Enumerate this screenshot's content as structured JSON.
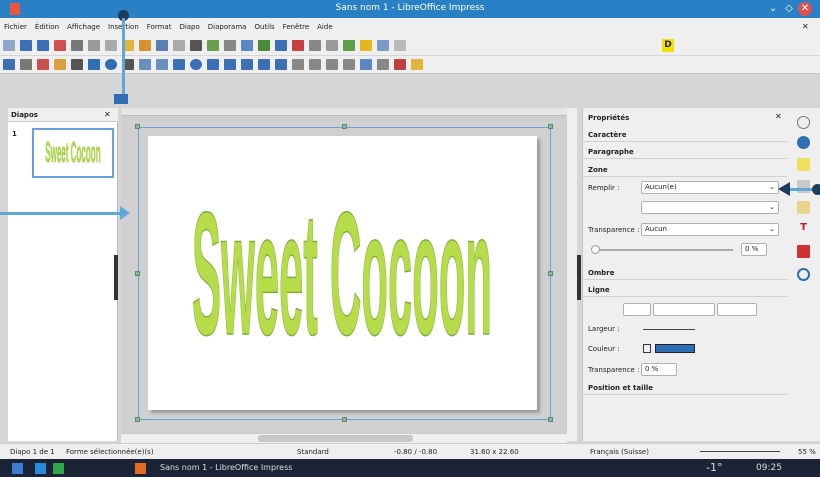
{
  "window": {
    "title": "Sans nom 1 - LibreOffice Impress"
  },
  "menus": [
    "Fichier",
    "Édition",
    "Affichage",
    "Insertion",
    "Format",
    "Diapo",
    "Diaporama",
    "Outils",
    "Fenêtre",
    "Aide"
  ],
  "slides_panel": {
    "title": "Diapos",
    "items": [
      {
        "number": "1",
        "text": "Sweet Cocoon"
      }
    ]
  },
  "slide": {
    "wordart": "Sweet Cocoon",
    "fill_color": "#b6dc4a",
    "stroke_color": "#7faa3a"
  },
  "properties": {
    "title": "Propriétés",
    "sections": {
      "caractere": "Caractère",
      "paragraphe": "Paragraphe",
      "zone": "Zone",
      "ombre": "Ombre",
      "ligne": "Ligne",
      "position": "Position et taille"
    },
    "zone": {
      "remplir_label": "Remplir :",
      "remplir_value": "Aucun(e)",
      "transparence_label": "Transparence :",
      "transparence_value": "Aucun",
      "transparence_percent": "0 %"
    },
    "ligne": {
      "largeur_label": "Largeur :",
      "couleur_label": "Couleur :",
      "transparence_label": "Transparence :",
      "transparence_value": "0 %",
      "line_color": "#2f6db4"
    }
  },
  "status": {
    "slide": "Diapo 1 de 1",
    "selection": "Forme sélectionnée(e)(s)",
    "layout": "Standard",
    "position": "-0.80 / -0.80",
    "size": "31.60 x 22.60",
    "language": "Français (Suisse)",
    "zoom": "55 %"
  },
  "taskbar": {
    "task": "Sans nom 1 - LibreOffice Impress",
    "temp": "-1°",
    "time": "09:25"
  }
}
